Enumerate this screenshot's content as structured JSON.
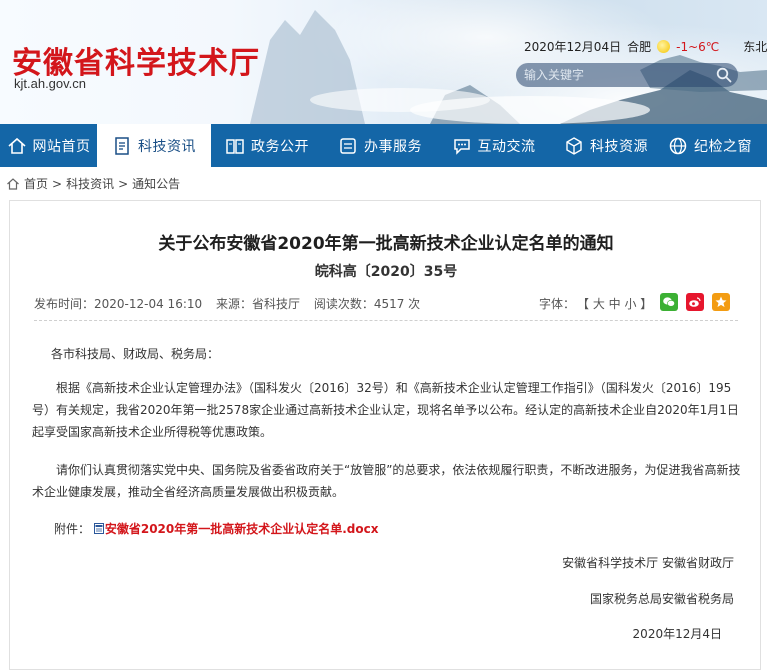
{
  "header": {
    "site_title": "安徽省科学技术厅",
    "site_url": "kjt.ah.gov.cn",
    "date": "2020年12月04日",
    "city": "合肥",
    "temperature": "-1~6℃",
    "wind": "东北",
    "search_placeholder": "输入关键字"
  },
  "nav": {
    "items": [
      {
        "label": "网站首页",
        "icon": "home-icon"
      },
      {
        "label": "科技资讯",
        "icon": "document-icon",
        "active": true
      },
      {
        "label": "政务公开",
        "icon": "book-icon"
      },
      {
        "label": "办事服务",
        "icon": "service-icon"
      },
      {
        "label": "互动交流",
        "icon": "chat-icon"
      },
      {
        "label": "科技资源",
        "icon": "cube-icon"
      },
      {
        "label": "纪检之窗",
        "icon": "globe-icon"
      }
    ]
  },
  "breadcrumb": {
    "items": [
      "首页",
      "科技资讯",
      "通知公告"
    ],
    "separator": ">"
  },
  "article": {
    "title": "关于公布安徽省2020年第一批高新技术企业认定名单的通知",
    "doc_number": "皖科高〔2020〕35号",
    "publish_time": "发布时间：2020-12-04 16:10",
    "source": "来源：省科技厅",
    "views": "阅读次数：4517 次",
    "font_label": "字体：",
    "font_sizes": "【 大 中 小 】",
    "salutation": "各市科技局、财政局、税务局：",
    "paragraph1": "根据《高新技术企业认定管理办法》（国科发火〔2016〕32号）和《高新技术企业认定管理工作指引》（国科发火〔2016〕195号）有关规定，我省2020年第一批2578家企业通过高新技术企业认定，现将名单予以公布。经认定的高新技术企业自2020年1月1日起享受国家高新技术企业所得税等优惠政策。",
    "paragraph2": "请你们认真贯彻落实党中央、国务院及省委省政府关于“放管服”的总要求，依法依规履行职责，不断改进服务，为促进我省高新技术企业健康发展，推动全省经济高质量发展做出积极贡献。",
    "attachment_label": "附件：",
    "attachment_name": "安徽省2020年第一批高新技术企业认定名单.docx",
    "sign1": "安徽省科学技术厅 安徽省财政厅",
    "sign2": "国家税务总局安徽省税务局",
    "sign_date": "2020年12月4日"
  },
  "colors": {
    "brand_red": "#d3161b",
    "nav_blue": "#1466a7",
    "wechat_green": "#3cb034",
    "weibo_red": "#e6162d",
    "favorite_orange": "#f39c12"
  }
}
